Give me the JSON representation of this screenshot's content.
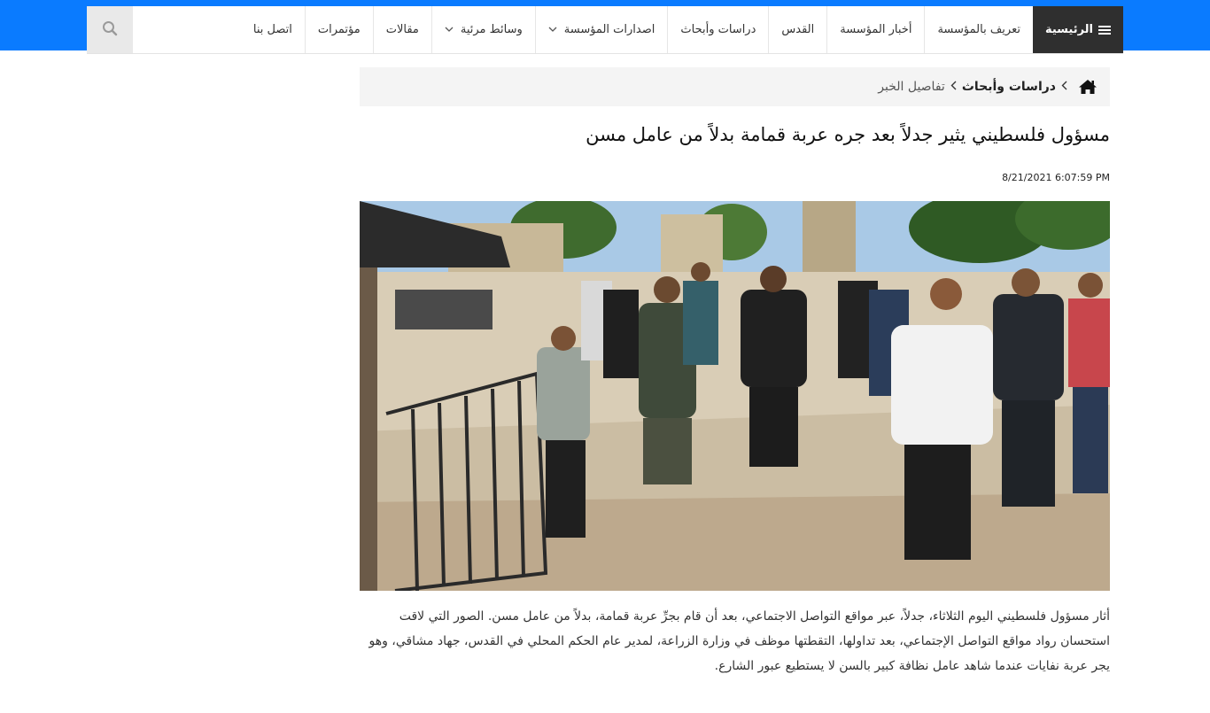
{
  "nav": {
    "items": [
      {
        "label": "الرئيسية",
        "active": true
      },
      {
        "label": "تعريف بالمؤسسة"
      },
      {
        "label": "أخبار المؤسسة"
      },
      {
        "label": "القدس"
      },
      {
        "label": "دراسات وأبحاث"
      },
      {
        "label": "اصدارات المؤسسة",
        "dropdown": true
      },
      {
        "label": "وسائط مرئية",
        "dropdown": true
      },
      {
        "label": "مقالات"
      },
      {
        "label": "مؤتمرات"
      },
      {
        "label": "اتصل بنا"
      }
    ],
    "search_icon": "search-icon"
  },
  "breadcrumb": {
    "home_icon": "home-icon",
    "section": "دراسات وأبحاث",
    "current": "تفاصيل الخبر"
  },
  "article": {
    "title": "مسؤول فلسطيني يثير جدلاً بعد جره عربة قمامة بدلاً من عامل مسن",
    "date": "8/21/2021 6:07:59 PM",
    "body": "أثار مسؤول فلسطيني اليوم الثلاثاء، جدلاً، عبر مواقع التواصل الاجتماعي، بعد أن قام بجرِّ عربة قمامة، بدلاً من عامل مسن. الصور التي لاقت استحسان رواد مواقع التواصل الإجتماعي، بعد تداولها، التقطتها موظف في وزارة الزراعة، لمدير عام الحكم المحلي في القدس، جهاد مشاقي، وهو يجر عربة نفايات عندما شاهد عامل نظافة كبير بالسن لا يستطيع عبور الشارع."
  },
  "colors": {
    "top_strip": "#0a7bff",
    "nav_active_bg": "#2f2f2f",
    "breadcrumb_bg": "#f4f4f4"
  }
}
